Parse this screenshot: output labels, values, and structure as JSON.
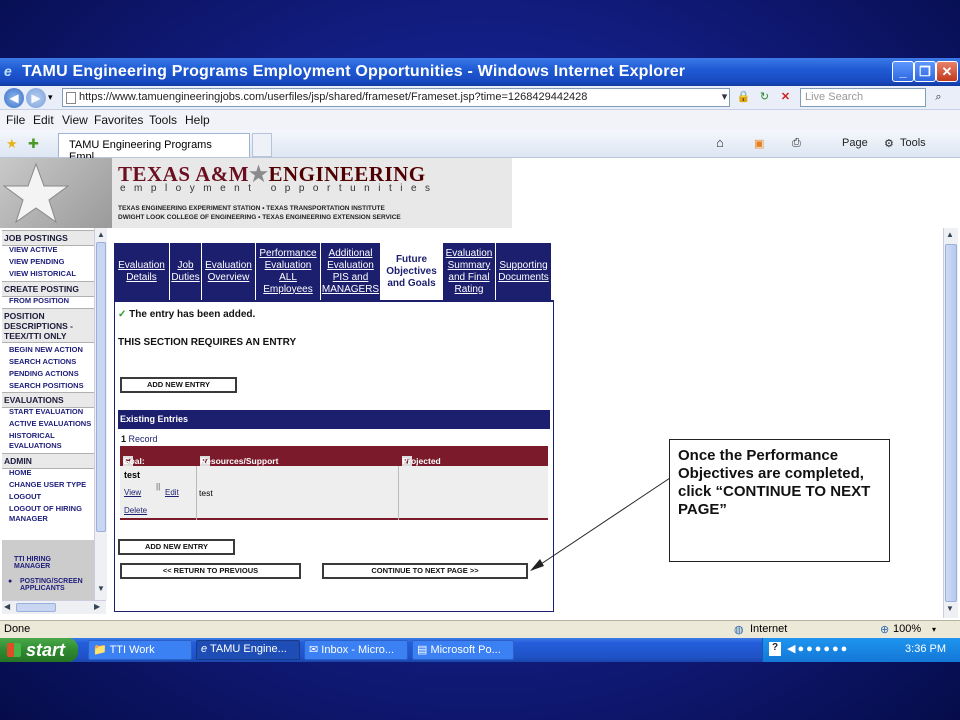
{
  "window": {
    "title": "TAMU Engineering Programs Employment Opportunities - Windows Internet Explorer",
    "address": "https://www.tamuengineeringjobs.com/userfiles/jsp/shared/frameset/Frameset.jsp?time=1268429442428",
    "search_placeholder": "Live Search"
  },
  "menu": [
    "File",
    "Edit",
    "View",
    "Favorites",
    "Tools",
    "Help"
  ],
  "tab": {
    "label": "TAMU Engineering Programs Empl..."
  },
  "command_bar": {
    "page": "Page",
    "tools": "Tools"
  },
  "banner": {
    "title_a": "TEXAS A&M",
    "title_b": "ENGINEERING",
    "subtitle": "employment opportunities",
    "line1": "TEXAS ENGINEERING EXPERIMENT STATION • TEXAS TRANSPORTATION INSTITUTE",
    "line2": "DWIGHT LOOK COLLEGE OF ENGINEERING • TEXAS ENGINEERING EXTENSION SERVICE"
  },
  "sidebar": {
    "sections": [
      {
        "heading": "JOB POSTINGS",
        "items": [
          "VIEW ACTIVE",
          "VIEW PENDING",
          "VIEW HISTORICAL"
        ]
      },
      {
        "heading": "CREATE POSTING",
        "items": [
          "FROM POSITION"
        ]
      },
      {
        "heading": "POSITION DESCRIPTIONS - TEEX/TTI ONLY",
        "items": [
          "BEGIN NEW ACTION",
          "SEARCH ACTIONS",
          "PENDING ACTIONS",
          "SEARCH POSITIONS"
        ]
      },
      {
        "heading": "EVALUATIONS",
        "items": [
          "START EVALUATION",
          "ACTIVE EVALUATIONS",
          "HISTORICAL EVALUATIONS"
        ]
      },
      {
        "heading": "ADMIN",
        "items": [
          "HOME",
          "CHANGE USER TYPE",
          "LOGOUT",
          "LOGOUT OF HIRING MANAGER"
        ]
      }
    ],
    "footer": [
      "TTI HIRING MANAGER",
      "POSTING/SCREEN APPLICANTS"
    ]
  },
  "eval_tabs": [
    "Evaluation Details",
    "Job Duties",
    "Evaluation Overview",
    "Performance Evaluation ALL Employees",
    "Additional Evaluation PIS and MANAGERS",
    "Future Objectives and Goals",
    "Evaluation Summary and Final Rating",
    "Supporting Documents"
  ],
  "main": {
    "success_msg": "The entry has been added.",
    "requires_entry": "THIS SECTION REQUIRES AN ENTRY",
    "add_new_entry": "ADD NEW ENTRY",
    "existing_entries": "Existing Entries",
    "record_count": "1",
    "record_label": "Record",
    "columns": [
      "Goal:",
      "Resources/Support Needed:",
      "Projected Due Date:"
    ],
    "row": {
      "goal": "test",
      "resources": "test",
      "due_date": "",
      "view": "View",
      "edit": "Edit",
      "delete": "Delete"
    },
    "return_button": "<< RETURN TO PREVIOUS",
    "continue_button": "CONTINUE TO NEXT PAGE >>"
  },
  "callout": "Once the Performance Objectives are completed, click “CONTINUE TO NEXT PAGE”",
  "status": {
    "left": "Done",
    "zone": "Internet",
    "zoom": "100%"
  },
  "taskbar": {
    "start": "start",
    "items": [
      "TTI Work",
      "TAMU Engine...",
      "Inbox - Micro...",
      "Microsoft Po..."
    ],
    "clock": "3:36 PM"
  }
}
